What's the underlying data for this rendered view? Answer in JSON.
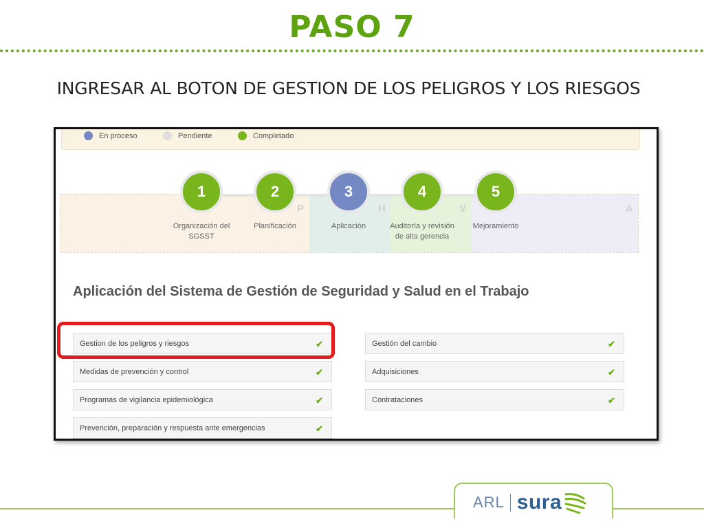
{
  "slide": {
    "title": "PASO 7",
    "subtitle": "INGRESAR AL BOTON DE GESTION DE LOS PELIGROS Y LOS RIESGOS"
  },
  "legend": [
    {
      "label": "En proceso",
      "color": "#7489c3"
    },
    {
      "label": "Pendiente",
      "color": "#dedede"
    },
    {
      "label": "Completado",
      "color": "#79b51c"
    }
  ],
  "phva": [
    {
      "letter": "P",
      "color": "#fbf1e4"
    },
    {
      "letter": "H",
      "color": "#e1eee9"
    },
    {
      "letter": "V",
      "color": "#e6f2da"
    },
    {
      "letter": "A",
      "color": "#eeecf6"
    }
  ],
  "steps": [
    {
      "number": "1",
      "label": "Organización del SGSST",
      "status": "completed"
    },
    {
      "number": "2",
      "label": "Planificación",
      "status": "completed"
    },
    {
      "number": "3",
      "label": "Aplicación",
      "status": "in-progress"
    },
    {
      "number": "4",
      "label": "Auditoría y revisión de alta gerencia",
      "status": "completed"
    },
    {
      "number": "5",
      "label": "Mejoramiento",
      "status": "completed"
    }
  ],
  "section": {
    "heading": "Aplicación del Sistema de Gestión de Seguridad y Salud en el Trabajo"
  },
  "tasks_left": [
    {
      "label": "Gestion de los peligros y riesgos",
      "check": "✔"
    },
    {
      "label": "Medidas de prevención y control",
      "check": "✔"
    },
    {
      "label": "Programas de vigilancia epidemiológica",
      "check": "✔"
    },
    {
      "label": "Prevención, preparación y respuesta ante emergencias",
      "check": "✔"
    }
  ],
  "tasks_right": [
    {
      "label": "Gestión del cambio",
      "check": "✔"
    },
    {
      "label": "Adquisiciones",
      "check": "✔"
    },
    {
      "label": "Contrataciones",
      "check": "✔"
    }
  ],
  "brand": {
    "arl": "ARL",
    "sura": "sura"
  },
  "colors": {
    "accent": "#5da30f",
    "highlight": "#e11d1d",
    "completed": "#79b51c",
    "in_progress": "#7489c3"
  }
}
